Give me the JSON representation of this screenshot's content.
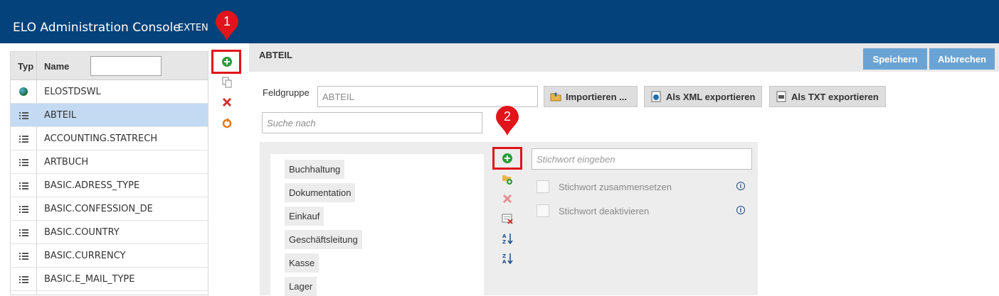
{
  "header": {
    "title": "ELO Administration Console",
    "tenant": "EXTEN"
  },
  "left_table": {
    "col_type": "Typ",
    "col_name": "Name",
    "filter_value": "",
    "rows": [
      {
        "label": "ELOSTDSWL",
        "icon": "globe-icon"
      },
      {
        "label": "ABTEIL",
        "icon": "list-icon",
        "selected": true
      },
      {
        "label": "ACCOUNTING.STATRECH",
        "icon": "list-icon"
      },
      {
        "label": "ARTBUCH",
        "icon": "list-icon"
      },
      {
        "label": "BASIC.ADRESS_TYPE",
        "icon": "list-icon"
      },
      {
        "label": "BASIC.CONFESSION_DE",
        "icon": "list-icon"
      },
      {
        "label": "BASIC.COUNTRY",
        "icon": "list-icon"
      },
      {
        "label": "BASIC.CURRENCY",
        "icon": "list-icon"
      },
      {
        "label": "BASIC.E_MAIL_TYPE",
        "icon": "list-icon"
      }
    ]
  },
  "markers": {
    "one": "1",
    "two": "2"
  },
  "detail": {
    "title": "ABTEIL",
    "save": "Speichern",
    "cancel": "Abbrechen",
    "fieldgroup_label": "Feldgruppe",
    "fieldgroup_value": "ABTEIL",
    "import": "Importieren ...",
    "export_xml": "Als XML exportieren",
    "export_txt": "Als TXT exportieren",
    "search_placeholder": "Suche nach",
    "keyword_placeholder": "Stichwort eingeben",
    "compose_label": "Stichwort zusammensetzen",
    "deactivate_label": "Stichwort deaktivieren",
    "keywords": [
      "Buchhaltung",
      "Dokumentation",
      "Einkauf",
      "Geschäftsleitung",
      "Kasse",
      "Lager"
    ]
  },
  "colors": {
    "header": "#03427a",
    "accent": "#6ba4d4",
    "selected_row": "#c3daf2",
    "marker_red": "#e0141a"
  }
}
